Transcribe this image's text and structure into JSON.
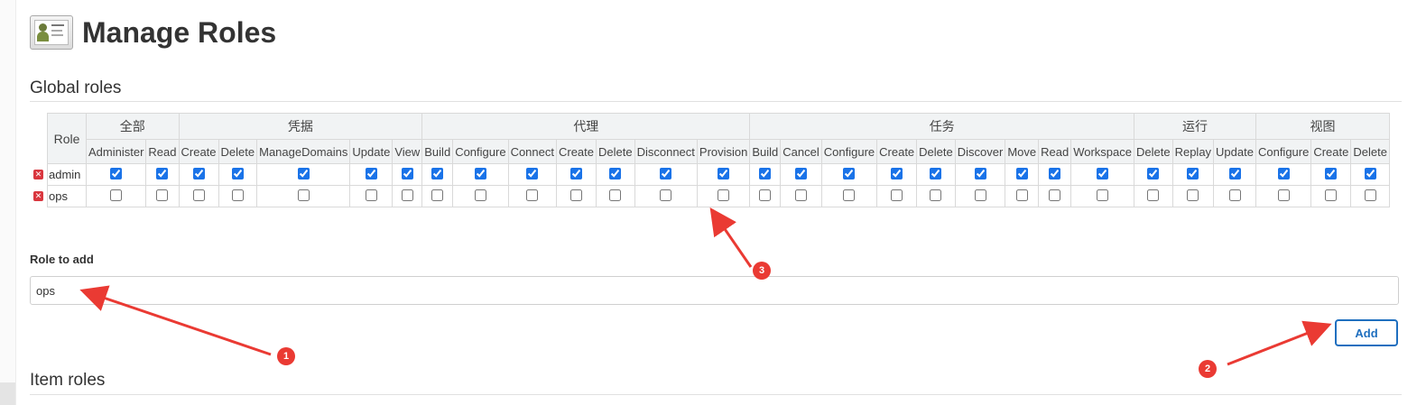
{
  "page": {
    "title": "Manage Roles",
    "header_icon": "id-card-icon"
  },
  "global_roles": {
    "heading": "Global roles",
    "role_column_header": "Role",
    "groups": [
      {
        "label": "全部",
        "permissions": [
          "Administer",
          "Read"
        ]
      },
      {
        "label": "凭据",
        "permissions": [
          "Create",
          "Delete",
          "ManageDomains",
          "Update",
          "View"
        ]
      },
      {
        "label": "代理",
        "permissions": [
          "Build",
          "Configure",
          "Connect",
          "Create",
          "Delete",
          "Disconnect",
          "Provision"
        ]
      },
      {
        "label": "任务",
        "permissions": [
          "Build",
          "Cancel",
          "Configure",
          "Create",
          "Delete",
          "Discover",
          "Move",
          "Read",
          "Workspace"
        ]
      },
      {
        "label": "运行",
        "permissions": [
          "Delete",
          "Replay",
          "Update"
        ]
      },
      {
        "label": "视图",
        "permissions": [
          "Configure",
          "Create",
          "Delete"
        ]
      }
    ],
    "roles": [
      {
        "name": "admin",
        "all_checked": true
      },
      {
        "name": "ops",
        "all_checked": false
      }
    ],
    "delete_icon": "delete-x-icon"
  },
  "add_role": {
    "label": "Role to add",
    "value": "ops",
    "button_label": "Add"
  },
  "item_roles": {
    "heading": "Item roles"
  },
  "annotations": {
    "badges": [
      "1",
      "2",
      "3"
    ],
    "color": "#ea3a33"
  },
  "colors": {
    "accent": "#1f6fbf",
    "checkbox": "#1a73e8",
    "header_bg": "#f1f3f4",
    "delete": "#d9363e"
  }
}
